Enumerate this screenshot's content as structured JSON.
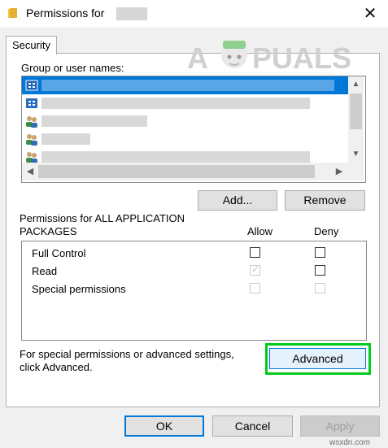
{
  "window": {
    "title": "Permissions for",
    "close_glyph": "✕"
  },
  "tabs": [
    {
      "label": "Security"
    }
  ],
  "watermark": {
    "text_left": "A",
    "text_right": "PUALS"
  },
  "group_list": {
    "label": "Group or user names:"
  },
  "buttons": {
    "add": "Add...",
    "remove": "Remove",
    "advanced": "Advanced",
    "ok": "OK",
    "cancel": "Cancel",
    "apply": "Apply"
  },
  "permissions": {
    "title": "Permissions for ALL APPLICATION PACKAGES",
    "allow_header": "Allow",
    "deny_header": "Deny",
    "rows": [
      {
        "label": "Full Control",
        "allow": false,
        "deny": false,
        "enabled": true
      },
      {
        "label": "Read",
        "allow": true,
        "deny": false,
        "enabled": true,
        "allow_disabled": true
      },
      {
        "label": "Special permissions",
        "allow": false,
        "deny": false,
        "enabled": false
      }
    ]
  },
  "advanced_text": "For special permissions or advanced settings, click Advanced.",
  "footer_site": "wsxdn.com",
  "colors": {
    "highlight": "#00cc1a",
    "selection": "#0078d7",
    "accent": "#0078d7"
  }
}
